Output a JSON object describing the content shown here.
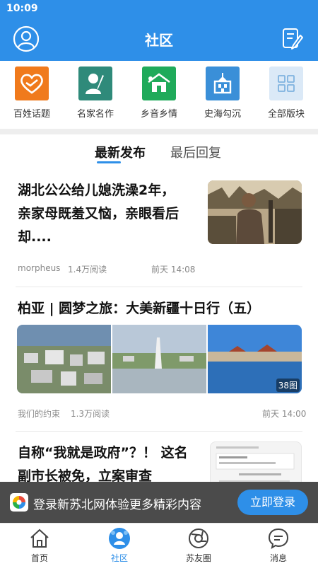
{
  "status": {
    "time": "10:09"
  },
  "header": {
    "title": "社区"
  },
  "categories": [
    {
      "label": "百姓话题",
      "color": "#f07a1c",
      "icon": "heart-icon"
    },
    {
      "label": "名家名作",
      "color": "#2f8a7a",
      "icon": "writer-icon"
    },
    {
      "label": "乡音乡情",
      "color": "#1faa5a",
      "icon": "house-icon"
    },
    {
      "label": "史海勾沉",
      "color": "#3a8fd8",
      "icon": "building-icon"
    },
    {
      "label": "全部版块",
      "color": "#dbe9f7",
      "icon": "grid-icon"
    }
  ],
  "tabs": {
    "active": "最新发布",
    "inactive": "最后回复"
  },
  "posts": [
    {
      "title_lines": [
        "湖北公公给儿媳洗澡2年，",
        "亲家母既羞又恼，亲眼看后",
        "却...."
      ],
      "author": "morpheus",
      "views": "1.4万阅读",
      "time": "前天 14:08"
    },
    {
      "title": "柏亚 | 圆梦之旅：大美新疆十日行（五）",
      "image_count": "38图",
      "author": "我们的约束",
      "views": "1.3万阅读",
      "time": "前天 14:00"
    },
    {
      "title_lines": [
        "自称“我就是政府”？！ 这名",
        "副市长被免，立案审查"
      ]
    }
  ],
  "banner": {
    "text": "登录新苏北网体验更多精彩内容",
    "button": "立即登录"
  },
  "bottom_nav": [
    {
      "label": "首页",
      "icon": "home-icon"
    },
    {
      "label": "社区",
      "icon": "community-icon"
    },
    {
      "label": "苏友圈",
      "icon": "circle-icon"
    },
    {
      "label": "消息",
      "icon": "message-icon"
    }
  ],
  "colors": {
    "primary": "#2e8fe8",
    "divider": "#eeeeee"
  }
}
